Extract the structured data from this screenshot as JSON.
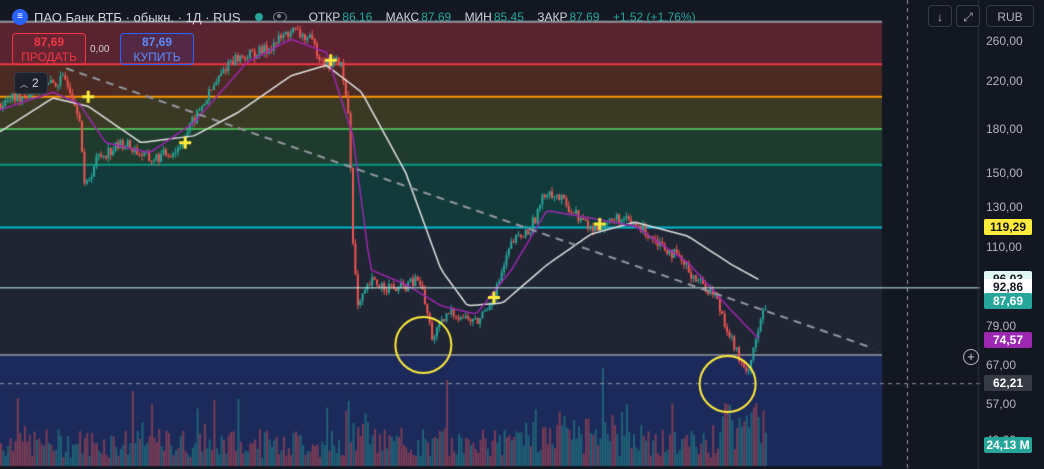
{
  "header": {
    "logo_glyph": "≡",
    "title": "ПАО Банк ВТБ · обыкн. · 1Д · RUS",
    "status_dot_color": "#26a69a",
    "ohlc": [
      {
        "key": "ОТКР",
        "value": "86,16"
      },
      {
        "key": "МАКС",
        "value": "87,69"
      },
      {
        "key": "МИН",
        "value": "85,45"
      },
      {
        "key": "ЗАКР",
        "value": "87,69"
      },
      {
        "key": "",
        "value": "+1,52 (+1,76%)"
      }
    ]
  },
  "trade": {
    "sell_price": "87,69",
    "sell_label": "ПРОДАТЬ",
    "spread": "0,00",
    "buy_price": "87,69",
    "buy_label": "КУПИТЬ"
  },
  "indicators_collapse": {
    "count": "2"
  },
  "toolbar": {
    "down_icon": "↓",
    "fullscreen_icon": "⤢",
    "currency": "RUB"
  },
  "axis": {
    "ticks": [
      "260,00",
      "220,00",
      "180,00",
      "150,00",
      "130,00",
      "110,00",
      "79,00",
      "67,00",
      "57,00",
      "49,00"
    ],
    "tick_values": [
      260,
      220,
      180,
      150,
      130,
      110,
      79,
      67,
      57,
      49
    ]
  },
  "price_labels": [
    {
      "text": "119,29",
      "value": 119.29,
      "bg": "#ffeb3b",
      "fg": "#131722"
    },
    {
      "text": "96,03",
      "value": 96.03,
      "bg": "#e0f7f4",
      "fg": "#131722"
    },
    {
      "text": "92,86",
      "value": 92.86,
      "bg": "#ffffff",
      "fg": "#131722"
    },
    {
      "text": "87,69",
      "value": 87.69,
      "bg": "#26a69a",
      "fg": "#ffffff"
    },
    {
      "text": "74,57",
      "value": 74.57,
      "bg": "#9c27b0",
      "fg": "#ffffff"
    },
    {
      "text": "62,21",
      "value": 62.21,
      "bg": "#363a45",
      "fg": "#ffffff"
    },
    {
      "text": "24,13 M",
      "value": null,
      "bg": "#26a69a",
      "fg": "#ffffff"
    }
  ],
  "colors": {
    "background": "#131722",
    "bull": "#26a69a",
    "bear": "#ef5350",
    "ma_fast": "#9c27b0",
    "ma_slow": "#e0e0e0",
    "marker": "#ffeb3b",
    "trendline": "#9598a1"
  },
  "chart_data": {
    "type": "candlestick",
    "scale": "log",
    "ylim": [
      44,
      290
    ],
    "fib_levels": [
      {
        "value": 282,
        "color": "#9598a1",
        "fill": "#5a2330"
      },
      {
        "value": 236,
        "color": "#f23645",
        "fill": "#4a2a22"
      },
      {
        "value": 206,
        "color": "#ff9800",
        "fill": "#3a3a24"
      },
      {
        "value": 180,
        "color": "#4caf50",
        "fill": "#1f3b2e"
      },
      {
        "value": 155,
        "color": "#089981",
        "fill": "#123a3a"
      },
      {
        "value": 119.29,
        "color": "#00bcd4",
        "fill": "#1f2533"
      },
      {
        "value": 70,
        "color": "#787b86",
        "fill": "#1b2a5a"
      }
    ],
    "horizontal_lines": [
      {
        "value": 92.86,
        "color": "#c9f3ee"
      },
      {
        "value": 62.21,
        "color": "#9598a1",
        "style": "dashed"
      }
    ],
    "close_path": [
      {
        "t": 0.0,
        "v": 200
      },
      {
        "t": 0.04,
        "v": 212
      },
      {
        "t": 0.075,
        "v": 222
      },
      {
        "t": 0.09,
        "v": 190
      },
      {
        "t": 0.095,
        "v": 140
      },
      {
        "t": 0.11,
        "v": 160
      },
      {
        "t": 0.14,
        "v": 170
      },
      {
        "t": 0.17,
        "v": 158
      },
      {
        "t": 0.2,
        "v": 165
      },
      {
        "t": 0.23,
        "v": 200
      },
      {
        "t": 0.26,
        "v": 240
      },
      {
        "t": 0.3,
        "v": 250
      },
      {
        "t": 0.33,
        "v": 272
      },
      {
        "t": 0.35,
        "v": 262
      },
      {
        "t": 0.37,
        "v": 235
      },
      {
        "t": 0.385,
        "v": 240
      },
      {
        "t": 0.395,
        "v": 190
      },
      {
        "t": 0.4,
        "v": 110
      },
      {
        "t": 0.405,
        "v": 85
      },
      {
        "t": 0.42,
        "v": 95
      },
      {
        "t": 0.45,
        "v": 92
      },
      {
        "t": 0.475,
        "v": 96
      },
      {
        "t": 0.49,
        "v": 75
      },
      {
        "t": 0.51,
        "v": 84
      },
      {
        "t": 0.54,
        "v": 80
      },
      {
        "t": 0.56,
        "v": 90
      },
      {
        "t": 0.58,
        "v": 112
      },
      {
        "t": 0.6,
        "v": 118
      },
      {
        "t": 0.62,
        "v": 140
      },
      {
        "t": 0.64,
        "v": 132
      },
      {
        "t": 0.67,
        "v": 118
      },
      {
        "t": 0.7,
        "v": 124
      },
      {
        "t": 0.73,
        "v": 118
      },
      {
        "t": 0.76,
        "v": 108
      },
      {
        "t": 0.79,
        "v": 96
      },
      {
        "t": 0.81,
        "v": 90
      },
      {
        "t": 0.83,
        "v": 74
      },
      {
        "t": 0.845,
        "v": 64
      },
      {
        "t": 0.86,
        "v": 79
      },
      {
        "t": 0.87,
        "v": 87.69
      }
    ],
    "ma_fast_path": [
      {
        "t": 0.0,
        "v": 195
      },
      {
        "t": 0.06,
        "v": 210
      },
      {
        "t": 0.09,
        "v": 200
      },
      {
        "t": 0.12,
        "v": 170
      },
      {
        "t": 0.17,
        "v": 163
      },
      {
        "t": 0.22,
        "v": 185
      },
      {
        "t": 0.28,
        "v": 238
      },
      {
        "t": 0.33,
        "v": 262
      },
      {
        "t": 0.37,
        "v": 248
      },
      {
        "t": 0.4,
        "v": 175
      },
      {
        "t": 0.42,
        "v": 100
      },
      {
        "t": 0.46,
        "v": 94
      },
      {
        "t": 0.5,
        "v": 86
      },
      {
        "t": 0.54,
        "v": 83
      },
      {
        "t": 0.58,
        "v": 100
      },
      {
        "t": 0.62,
        "v": 128
      },
      {
        "t": 0.67,
        "v": 124
      },
      {
        "t": 0.72,
        "v": 120
      },
      {
        "t": 0.78,
        "v": 103
      },
      {
        "t": 0.83,
        "v": 84
      },
      {
        "t": 0.86,
        "v": 75
      }
    ],
    "ma_slow_path": [
      {
        "t": 0.0,
        "v": 178
      },
      {
        "t": 0.06,
        "v": 205
      },
      {
        "t": 0.1,
        "v": 198
      },
      {
        "t": 0.16,
        "v": 170
      },
      {
        "t": 0.22,
        "v": 175
      },
      {
        "t": 0.27,
        "v": 193
      },
      {
        "t": 0.33,
        "v": 225
      },
      {
        "t": 0.37,
        "v": 235
      },
      {
        "t": 0.41,
        "v": 210
      },
      {
        "t": 0.46,
        "v": 150
      },
      {
        "t": 0.5,
        "v": 100
      },
      {
        "t": 0.53,
        "v": 86
      },
      {
        "t": 0.57,
        "v": 87
      },
      {
        "t": 0.62,
        "v": 102
      },
      {
        "t": 0.67,
        "v": 116
      },
      {
        "t": 0.72,
        "v": 122
      },
      {
        "t": 0.78,
        "v": 115
      },
      {
        "t": 0.83,
        "v": 102
      },
      {
        "t": 0.86,
        "v": 96
      }
    ],
    "trendline": [
      {
        "t": 0.075,
        "v": 232
      },
      {
        "t": 0.99,
        "v": 72
      }
    ],
    "cross_markers": [
      {
        "t": 0.1,
        "v": 206
      },
      {
        "t": 0.21,
        "v": 170
      },
      {
        "t": 0.375,
        "v": 240
      },
      {
        "t": 0.56,
        "v": 89
      },
      {
        "t": 0.68,
        "v": 121
      }
    ],
    "circles": [
      {
        "t": 0.48,
        "v": 73
      },
      {
        "t": 0.825,
        "v": 62
      }
    ]
  }
}
